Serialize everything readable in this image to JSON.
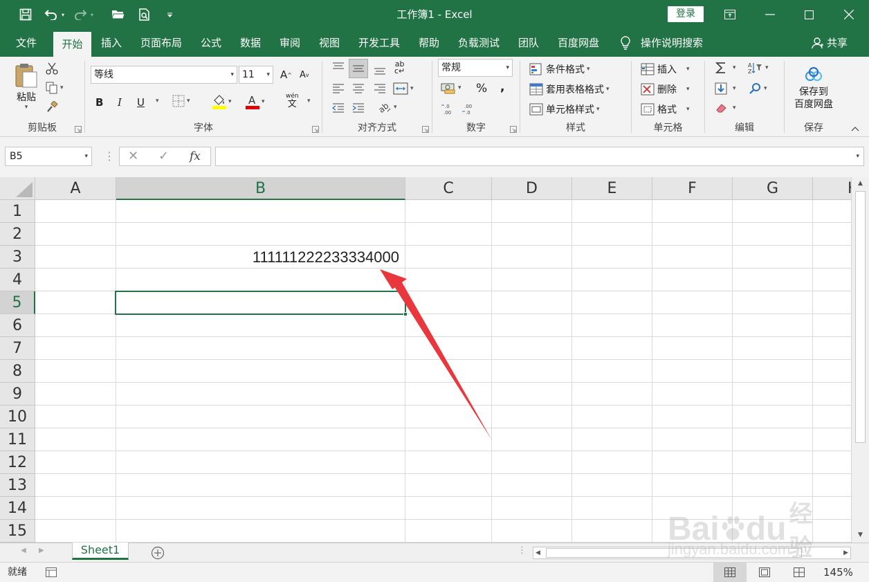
{
  "window": {
    "title": "工作簿1  -  Excel",
    "login_label": "登录"
  },
  "tabs": [
    "文件",
    "开始",
    "插入",
    "页面布局",
    "公式",
    "数据",
    "审阅",
    "视图",
    "开发工具",
    "帮助",
    "负载测试",
    "团队",
    "百度网盘",
    "操作说明搜索"
  ],
  "share_label": "共享",
  "ribbon": {
    "clipboard": {
      "paste_label": "粘贴",
      "group_label": "剪贴板"
    },
    "font": {
      "font_name": "等线",
      "font_size": "11",
      "bold": "B",
      "italic": "I",
      "underline": "U",
      "grow": "A",
      "shrink": "A",
      "phonetic_top": "wén",
      "phonetic_bottom": "文",
      "group_label": "字体"
    },
    "alignment": {
      "group_label": "对齐方式",
      "wrap_label": "ab"
    },
    "number": {
      "format": "常规",
      "percent": "%",
      "comma": ",",
      "group_label": "数字"
    },
    "styles": {
      "conditional": "条件格式",
      "table": "套用表格格式",
      "cell": "单元格样式",
      "group_label": "样式"
    },
    "cells": {
      "insert": "插入",
      "delete": "删除",
      "format": "格式",
      "group_label": "单元格"
    },
    "editing": {
      "group_label": "编辑"
    },
    "save": {
      "line1": "保存到",
      "line2": "百度网盘",
      "group_label": "保存"
    }
  },
  "formula_bar": {
    "name_box": "B5",
    "fx_label": "fx",
    "formula": ""
  },
  "grid": {
    "columns": [
      "A",
      "B",
      "C",
      "D",
      "E",
      "F",
      "G",
      "H"
    ],
    "selected_column": "B",
    "rows": [
      "1",
      "2",
      "3",
      "4",
      "5",
      "6",
      "7",
      "8",
      "9",
      "10",
      "11",
      "12",
      "13",
      "14",
      "15"
    ],
    "selected_row": "5",
    "cell_B3": "111111222233334000",
    "active_cell": "B5"
  },
  "sheets": {
    "tabs": [
      "Sheet1"
    ],
    "active": "Sheet1"
  },
  "status": {
    "text": "就绪",
    "zoom": "145%"
  },
  "watermark": {
    "brand": "Bai",
    "brand2": "du",
    "suffix": "经验",
    "url": "jingyan.baidu.com"
  },
  "colors": {
    "accent": "#217346",
    "arrow": "#e8383d",
    "ribbon_bg": "#f3f3f3",
    "header_bg": "#e6e6e6"
  }
}
